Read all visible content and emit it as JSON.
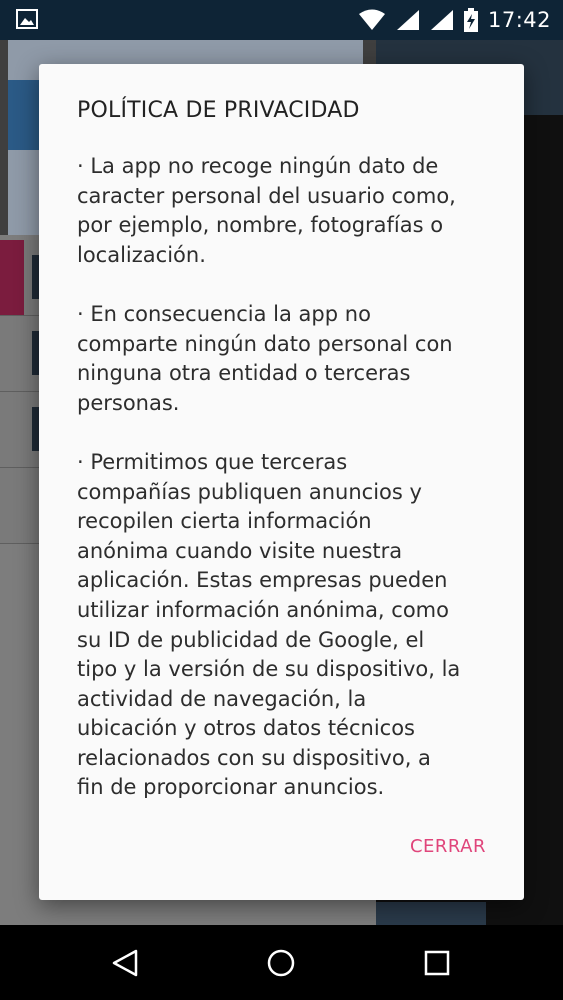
{
  "status_bar": {
    "time": "17:42",
    "icons": [
      "image-notification-icon",
      "wifi-icon",
      "signal-icon",
      "signal-icon",
      "battery-charging-icon"
    ]
  },
  "dialog": {
    "title": "POLÍTICA DE PRIVACIDAD",
    "paragraphs": [
      "  · La app no recoge ningún dato de\ncaracter personal del usuario como,\npor ejemplo, nombre, fotografías o\nlocalización.",
      "· En consecuencia la app no\ncomparte ningún dato personal con\nninguna otra entidad o terceras\npersonas.",
      "· Permitimos que terceras\ncompañías publiquen anuncios y\nrecopilen cierta información\nanónima cuando visite nuestra\naplicación. Estas empresas pueden\nutilizar información anónima, como\nsu ID de publicidad de Google, el\ntipo y la versión de su dispositivo, la\nactividad de navegación, la\nubicación y otros datos técnicos\nrelacionados con su dispositivo, a\nfin de proporcionar anuncios."
    ],
    "close_label": "CERRAR",
    "accent_color": "#e0457b"
  },
  "nav_bar": {
    "buttons": [
      "back-icon",
      "home-icon",
      "recents-icon"
    ]
  }
}
